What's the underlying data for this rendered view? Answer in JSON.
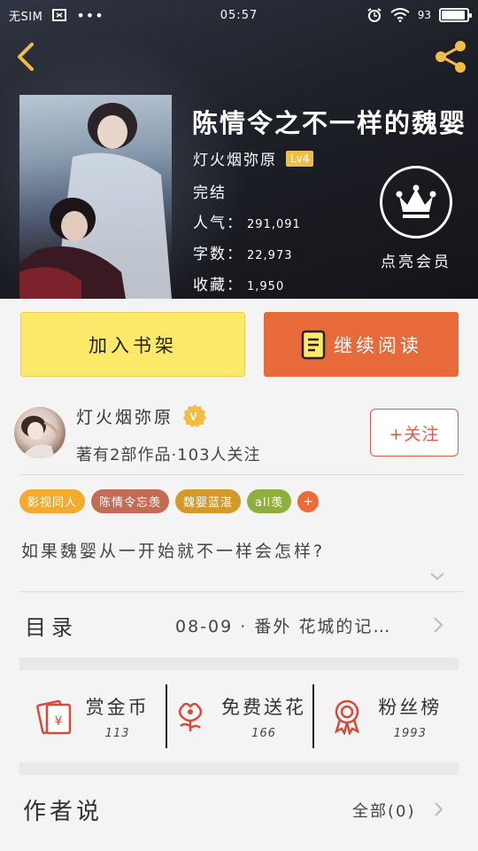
{
  "status_bar": {
    "carrier": "无SIM",
    "time": "05:57",
    "battery_text": "93",
    "battery_level": 0.93
  },
  "header": {
    "back_icon": "chevron-left-icon",
    "share_icon": "share-icon",
    "accent_color": "#f2bd47"
  },
  "book": {
    "title": "陈情令之不一样的魏婴",
    "author": "灯火烟弥原",
    "level": "Lv4",
    "status": "完结",
    "popularity_label": "人气：",
    "popularity": "291,091",
    "words_label": "字数：",
    "words": "22,973",
    "favorites_label": "收藏：",
    "favorites": "1,950",
    "vip_label": "点亮会员"
  },
  "actions": {
    "add_shelf": "加入书架",
    "continue_reading": "继续阅读",
    "shelf_color": "#fce96a",
    "read_color": "#e8693a"
  },
  "author_card": {
    "name": "灯火烟弥原",
    "verified_badge": "V",
    "stats": "著有2部作品·103人关注",
    "follow": "+关注"
  },
  "tags": [
    {
      "label": "影视同人",
      "color": "#f2ab2e"
    },
    {
      "label": "陈情令忘羡",
      "color": "#c46b55"
    },
    {
      "label": "魏婴蓝湛",
      "color": "#d39a2b"
    },
    {
      "label": "all羡",
      "color": "#8fae3d"
    }
  ],
  "tag_add": "+",
  "summary": "如果魏婴从一开始就不一样会怎样?",
  "toc": {
    "label": "目录",
    "latest": "08-09 · 番外 花城的记…"
  },
  "stats": [
    {
      "label": "赏金币",
      "value": "113",
      "icon": "red-envelope-icon"
    },
    {
      "label": "免费送花",
      "value": "166",
      "icon": "flower-icon"
    },
    {
      "label": "粉丝榜",
      "value": "1993",
      "icon": "medal-icon"
    }
  ],
  "author_says": {
    "label": "作者说",
    "all": "全部(0)"
  }
}
